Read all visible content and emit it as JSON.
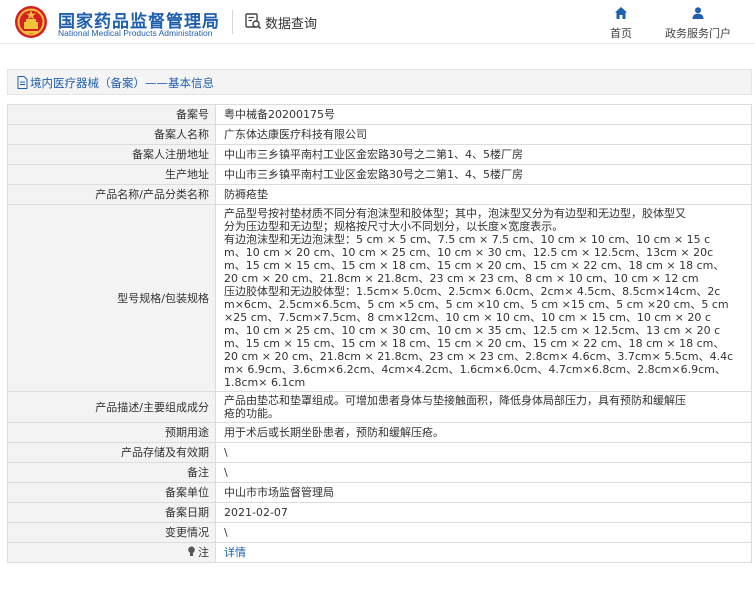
{
  "header": {
    "brand_cn": "国家药品监督管理局",
    "brand_en": "National Medical Products Administration",
    "query_label": "数据查询",
    "nav": [
      {
        "label": "首页",
        "icon": "home-icon"
      },
      {
        "label": "政务服务门户",
        "icon": "user-icon"
      }
    ]
  },
  "breadcrumb": {
    "icon": "document-icon",
    "text": "境内医疗器械（备案）——基本信息"
  },
  "colors": {
    "brand_blue": "#1f5fb0",
    "label_bg": "#f3f3f3",
    "border": "#dcdcdc"
  },
  "record": {
    "rows": [
      {
        "label": "备案号",
        "value": "粤中械备20200175号"
      },
      {
        "label": "备案人名称",
        "value": "广东体达康医疗科技有限公司"
      },
      {
        "label": "备案人注册地址",
        "value": "中山市三乡镇平南村工业区金宏路30号之二第1、4、5楼厂房"
      },
      {
        "label": "生产地址",
        "value": "中山市三乡镇平南村工业区金宏路30号之二第1、4、5楼厂房"
      },
      {
        "label": "产品名称/产品分类名称",
        "value": "防褥疮垫"
      },
      {
        "label": "型号规格/包装规格",
        "lines": [
          "产品型号按衬垫材质不同分有泡沫型和胶体型；其中，泡沫型又分为有边型和无边型，胶体型又",
          "分为压边型和无边型；规格按尺寸大小不同划分，以长度×宽度表示。",
          "有边泡沫型和无边泡沫型：5 cm × 5 cm、7.5 cm × 7.5 cm、10 cm × 10 cm、10 cm × 15 c",
          "m、10 cm × 20 cm、10 cm × 25 cm、10 cm × 30 cm、12.5 cm × 12.5cm、13cm × 20c",
          "m、15 cm × 15 cm、15 cm × 18 cm、15 cm × 20 cm、15 cm × 22 cm、18 cm × 18 cm、",
          "20 cm × 20 cm、21.8cm × 21.8cm、23 cm × 23 cm、8 cm × 10 cm、10 cm × 12 cm",
          "压边胶体型和无边胶体型：1.5cm× 5.0cm、2.5cm× 6.0cm、2cm× 4.5cm、8.5cm×14cm、2c",
          "m×6cm、2.5cm×6.5cm、5 cm ×5 cm、5 cm ×10 cm、5 cm ×15 cm、5 cm ×20 cm、5 cm",
          "×25 cm、7.5cm×7.5cm、8 cm×12cm、10 cm × 10 cm、10 cm × 15 cm、10 cm × 20 c",
          "m、10 cm × 25 cm、10 cm × 30 cm、10 cm × 35 cm、12.5 cm × 12.5cm、13 cm × 20 c",
          "m、15 cm × 15 cm、15 cm × 18 cm、15 cm × 20 cm、15 cm × 22 cm、18 cm × 18 cm、",
          "20 cm × 20 cm、21.8cm × 21.8cm、23 cm × 23 cm、2.8cm× 4.6cm、3.7cm× 5.5cm、4.4c",
          "m× 6.9cm、3.6cm×6.2cm、4cm×4.2cm、1.6cm×6.0cm、4.7cm×6.8cm、2.8cm×6.9cm、",
          "1.8cm× 6.1cm"
        ]
      },
      {
        "label": "产品描述/主要组成成分",
        "lines": [
          "产品由垫芯和垫罩组成。可增加患者身体与垫接触面积，降低身体局部压力，具有预防和缓解压",
          "疮的功能。"
        ]
      },
      {
        "label": "预期用途",
        "value": "用于术后或长期坐卧患者，预防和缓解压疮。"
      },
      {
        "label": "产品存储及有效期",
        "value": "\\"
      },
      {
        "label": "备注",
        "value": "\\"
      },
      {
        "label": "备案单位",
        "value": "中山市市场监督管理局"
      },
      {
        "label": "备案日期",
        "value": "2021-02-07"
      },
      {
        "label": "变更情况",
        "value": "\\"
      },
      {
        "label": "注",
        "value": "详情",
        "icon": "lightbulb-icon"
      }
    ]
  }
}
